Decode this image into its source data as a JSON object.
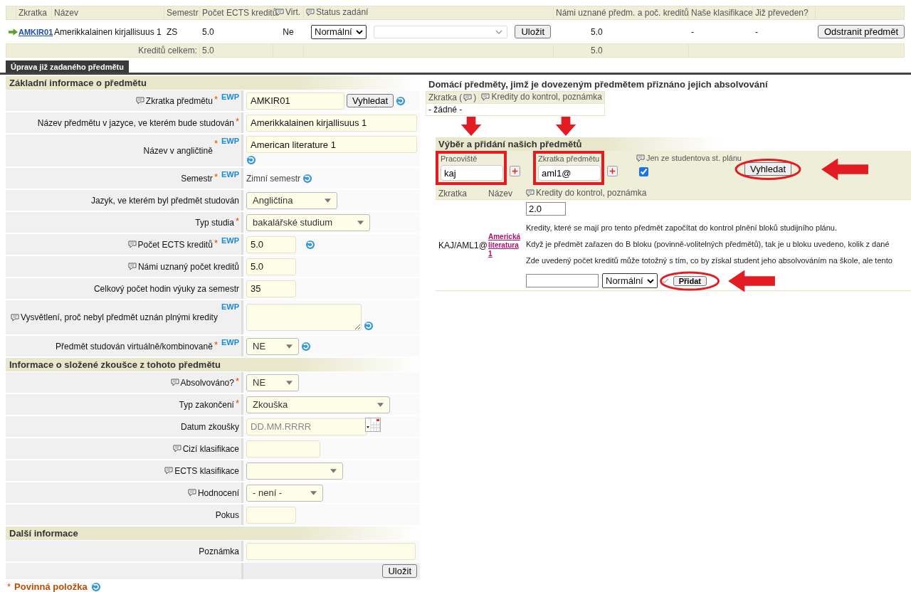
{
  "summary_table": {
    "columns": [
      {
        "label": "Zkratka",
        "comment": false
      },
      {
        "label": "Název",
        "comment": false
      },
      {
        "label": "Semestr",
        "comment": false
      },
      {
        "label": "Počet ECTS kreditů",
        "comment": false
      },
      {
        "label": "Virt.",
        "comment": true
      },
      {
        "label": "Status zadání",
        "comment": true
      },
      {
        "label": "Námi uznané předm. a poč. kreditů",
        "comment": false
      },
      {
        "label": "Naše klasifikace",
        "comment": false
      },
      {
        "label": "Již převeden?",
        "comment": false
      }
    ],
    "row": {
      "code": "AMKIR01",
      "name": "Amerikkalainen kirjallisuus 1",
      "semester": "ZS",
      "ects": "5.0",
      "virtual": "Ne",
      "status": "Normální",
      "save_button": "Uložit",
      "recognized": "5.0",
      "our_grade": "-",
      "transferred": "-",
      "remove_button": "Odstranit předmět"
    },
    "totals": {
      "label": "Kreditů celkem:",
      "ects": "5.0",
      "recognized": "5.0"
    }
  },
  "tab": {
    "label": "Úprava již zadaného předmětu",
    "selected": true
  },
  "form_sections": [
    {
      "title": "Základní informace o předmětu",
      "fields": [
        {
          "kind": "input",
          "label": "Zkratka předmětu",
          "comment": true,
          "mark": "*",
          "badge": "EWP",
          "value": "AMKIR01",
          "button": "Vyhledat",
          "help": true
        },
        {
          "kind": "input",
          "label": "Název předmětu v jazyce, ve kterém bude studován",
          "comment": false,
          "mark": "*",
          "value": "Amerikkalainen kirjallisuus 1",
          "help": false
        },
        {
          "kind": "input",
          "label": "Název v angličtině",
          "comment": false,
          "mark": "*",
          "badge": "EWP",
          "value": "American literature 1",
          "help": true
        },
        {
          "kind": "static",
          "label": "Semestr",
          "comment": false,
          "mark": "*",
          "badge": "EWP",
          "value": "Zimní semestr",
          "help": true
        },
        {
          "kind": "select",
          "label": "Jazyk, ve kterém byl předmět studován",
          "comment": false,
          "value": "Angličtina",
          "help": false
        },
        {
          "kind": "select",
          "label": "Typ studia",
          "comment": false,
          "mark": "*",
          "value": "bakalářské studium",
          "help": false
        },
        {
          "kind": "input",
          "label": "Počet ECTS kreditů",
          "comment": true,
          "mark": "*",
          "badge": "EWP",
          "value": "5.0",
          "help": true
        },
        {
          "kind": "input",
          "label": "Námi uznaný počet kreditů",
          "comment": true,
          "value": "5.0",
          "help": false
        },
        {
          "kind": "input",
          "label": "Celkový počet hodin výuky za semestr",
          "comment": false,
          "value": "35",
          "help": false
        },
        {
          "kind": "textarea",
          "label": "Vysvětlení, proč nebyl předmět uznán plnými kredity",
          "comment": true,
          "badge": "EWP",
          "help": true
        },
        {
          "kind": "select",
          "label": "Předmět studován virtuálně/kombinovaně",
          "comment": false,
          "mark": "*",
          "badge": "EWP",
          "value": "NE",
          "help": true
        }
      ]
    },
    {
      "title": "Informace o složené zkoušce z tohoto předmětu",
      "fields": [
        {
          "kind": "select",
          "label": "Absolvováno?",
          "comment": true,
          "mark": "*",
          "value": "NE",
          "help": false
        },
        {
          "kind": "select",
          "label": "Typ zakončení",
          "comment": false,
          "mark": "*",
          "value": "Zkouška",
          "help": false
        },
        {
          "kind": "date",
          "label": "Datum zkoušky",
          "comment": false,
          "placeholder": "DD.MM.RRRR",
          "help": false
        },
        {
          "kind": "input",
          "label": "Cizí klasifikace",
          "comment": true,
          "help": false
        },
        {
          "kind": "select",
          "label": "ECTS klasifikace",
          "comment": true,
          "help": false
        },
        {
          "kind": "select",
          "label": "Hodnocení",
          "comment": true,
          "value": "- není -",
          "help": false
        },
        {
          "kind": "input",
          "label": "Pokus",
          "comment": false,
          "help": false
        }
      ]
    },
    {
      "title": "Další informace",
      "fields": [
        {
          "kind": "input",
          "label": "Poznámka",
          "comment": false,
          "help": false
        }
      ]
    }
  ],
  "form_save_button": "Uložit",
  "required_note": {
    "mark": "*",
    "text": "Povinná položka"
  },
  "home_courses": {
    "title": "Domácí předměty, jimž je dovezeným předmětem přiznáno jejich absolvování",
    "columns": [
      {
        "label": "Zkratka (",
        "comment": true,
        "suffix": ")"
      },
      {
        "label": "Kredity do kontrol, poznámka",
        "comment": true
      }
    ],
    "empty": "- žádné -"
  },
  "search": {
    "title": "Výběr a přidání našich předmětů",
    "filters": [
      {
        "label": "Pracoviště",
        "value": "kaj"
      },
      {
        "label": "Zkratka předmětu",
        "value": "aml1@"
      }
    ],
    "only_plan": {
      "label": "Jen ze studentova st. plánu",
      "checked": true
    },
    "button": "Vyhledat",
    "results": {
      "columns": [
        {
          "label": "Zkratka",
          "comment": false
        },
        {
          "label": "Název",
          "comment": false
        },
        {
          "label": "Kredity do kontrol, poznámka",
          "comment": true
        }
      ],
      "rows": [
        {
          "code": "KAJ/AML1@",
          "name": "Americká literatura 1",
          "credits": "2.0",
          "notes": [
            "Kredity, které se mají pro tento předmět započítat do kontrol plnění bloků studijního plánu.",
            "Když je předmět zařazen do B bloku (povinně-volitelných předmětů), tak je u bloku uvedeno, kolik z dané",
            "Zde uvedený počet kreditů může totožný s tím, co by získal student jeho absolvováním na škole, ale tento"
          ],
          "status": "Normální",
          "add_button": "Přidat"
        }
      ]
    }
  }
}
